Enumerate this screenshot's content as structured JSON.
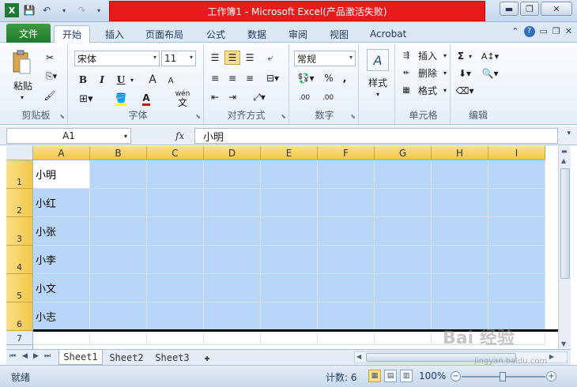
{
  "window": {
    "title": "工作簿1 - Microsoft Excel(产品激活失败)"
  },
  "quick_access": {
    "save_icon": "save-icon",
    "undo_icon": "undo-icon",
    "redo_icon": "redo-icon"
  },
  "ribbon_tabs": {
    "file": "文件",
    "items": [
      "开始",
      "插入",
      "页面布局",
      "公式",
      "数据",
      "审阅",
      "视图",
      "Acrobat"
    ],
    "active": "开始"
  },
  "ribbon": {
    "clipboard": {
      "label": "剪贴板",
      "paste": "粘贴"
    },
    "font": {
      "label": "字体",
      "name": "宋体",
      "size": "11",
      "bold": "B",
      "italic": "I",
      "underline": "U",
      "grow": "A",
      "shrink": "A",
      "phonetic": "wén"
    },
    "alignment": {
      "label": "对齐方式"
    },
    "number": {
      "label": "数字",
      "format": "常规",
      "percent": "%",
      "comma": ",",
      "inc": ".00",
      "dec": ".00"
    },
    "styles": {
      "label": "样式"
    },
    "cells": {
      "label": "单元格",
      "insert": "插入",
      "delete": "删除",
      "format": "格式"
    },
    "editing": {
      "label": "编辑",
      "sum": "Σ"
    }
  },
  "formula_bar": {
    "name_box": "A1",
    "fx": "fx",
    "value": "小明"
  },
  "grid": {
    "columns": [
      "A",
      "B",
      "C",
      "D",
      "E",
      "F",
      "G",
      "H",
      "I"
    ],
    "rows": [
      {
        "num": "1",
        "a": "小明"
      },
      {
        "num": "2",
        "a": "小红"
      },
      {
        "num": "3",
        "a": "小张"
      },
      {
        "num": "4",
        "a": "小李"
      },
      {
        "num": "5",
        "a": "小文"
      },
      {
        "num": "6",
        "a": "小志"
      },
      {
        "num": "7",
        "a": ""
      }
    ]
  },
  "sheets": {
    "tabs": [
      "Sheet1",
      "Sheet2",
      "Sheet3"
    ],
    "active": "Sheet1"
  },
  "status": {
    "ready": "就绪",
    "count": "计数: 6",
    "zoom": "100%"
  },
  "watermark": {
    "main": "Bai 经验",
    "sub": "jingyan.baidu.com"
  }
}
